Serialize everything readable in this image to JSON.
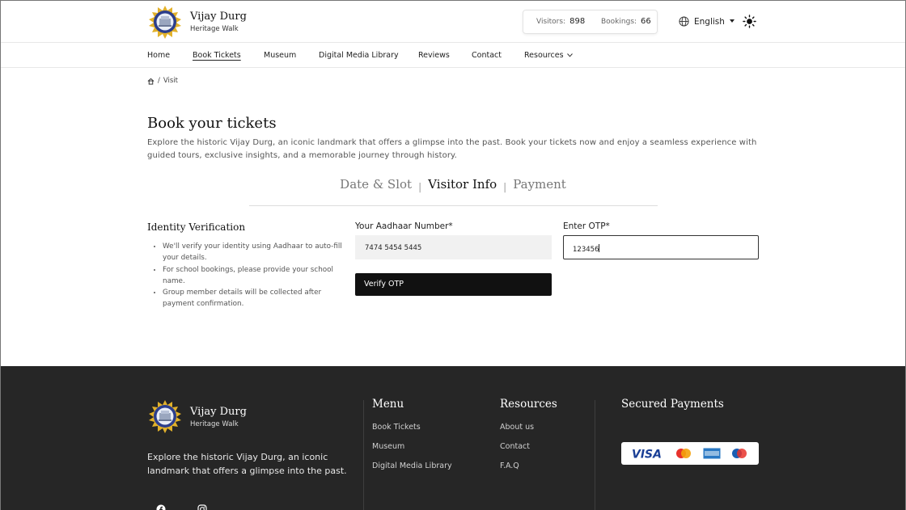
{
  "header": {
    "brand_name": "Vijay Durg",
    "brand_sub": "Heritage Walk",
    "visitors_label": "Visitors:",
    "visitors_value": "898",
    "bookings_label": "Bookings:",
    "bookings_value": "66",
    "language": "English"
  },
  "nav": {
    "items": [
      "Home",
      "Book Tickets",
      "Museum",
      "Digital Media Library",
      "Reviews",
      "Contact",
      "Resources"
    ],
    "active": "Book Tickets"
  },
  "breadcrumb": {
    "current": "Visit"
  },
  "main": {
    "title": "Book your tickets",
    "description": "Explore the historic Vijay Durg, an iconic landmark that offers a glimpse into the past. Book your tickets now and enjoy a seamless experience with guided tours, exclusive insights, and a memorable journey through history.",
    "steps": [
      "Date & Slot",
      "Visitor Info",
      "Payment"
    ],
    "active_step": "Visitor Info"
  },
  "identity": {
    "title": "Identity Verification",
    "points": [
      "We'll verify your identity using Aadhaar to auto-fill your details.",
      "For school bookings, please provide your school name.",
      "Group member details will be collected after payment confirmation."
    ]
  },
  "form": {
    "aadhaar_label": "Your Aadhaar Number*",
    "aadhaar_value": "7474 5454 5445",
    "otp_label": "Enter OTP*",
    "otp_value": "123456",
    "verify_label": "Verify OTP"
  },
  "footer": {
    "brand_name": "Vijay Durg",
    "brand_sub": "Heritage Walk",
    "description": "Explore the historic Vijay Durg, an iconic landmark that offers a glimpse into the past.",
    "menu_title": "Menu",
    "menu_items": [
      "Book Tickets",
      "Museum",
      "Digital Media Library"
    ],
    "resources_title": "Resources",
    "resources_items": [
      "About us",
      "Contact",
      "F.A.Q"
    ],
    "payments_title": "Secured Payments",
    "payment_logos": {
      "visa": "VISA",
      "mastercard": "MasterCard",
      "amex": "AMEX",
      "maestro": "Maestro"
    },
    "social_icons": [
      "facebook-icon",
      "instagram-icon"
    ]
  },
  "colors": {
    "footer_bg": "#262626",
    "button_bg": "#111111",
    "accent_gold": "#d4a72c",
    "logo_blue": "#2c3e8c"
  }
}
